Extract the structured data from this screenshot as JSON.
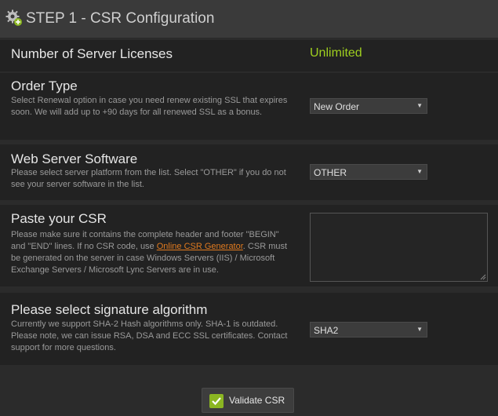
{
  "header": {
    "title": "STEP 1 - CSR Configuration"
  },
  "licenses": {
    "label": "Number of Server Licenses",
    "value": "Unlimited",
    "value_color": "#9fcf1f"
  },
  "order_type": {
    "label": "Order Type",
    "desc": "Select Renewal option in case you need renew existing SSL that expires soon. We will add up to +90 days for all renewed SSL as a bonus.",
    "selected": "New Order"
  },
  "web_server": {
    "label": "Web Server Software",
    "desc": "Please select server platform from the list. Select \"OTHER\" if you do not see your server software in the list.",
    "selected": "OTHER"
  },
  "csr": {
    "label": "Paste your CSR",
    "desc_before": "Please make sure it contains the complete header and footer \"BEGIN\" and \"END\" lines. If no CSR code, use ",
    "link": "Online CSR Generator",
    "desc_after": ". CSR must be generated on the server in case Windows Servers (IIS) / Microsoft Exchange Servers / Microsoft Lync Servers are in use.",
    "value": ""
  },
  "signature": {
    "label": "Please select signature algorithm",
    "desc": "Currently we support SHA-2 Hash algorithms only. SHA-1 is outdated. Please note, we can issue RSA, DSA and ECC SSL certificates. Contact support for more questions.",
    "selected": "SHA2"
  },
  "validate_button": {
    "label": "Validate CSR"
  },
  "icons": {
    "header": "gear-icon",
    "select_arrow": "caret-down-icon",
    "button": "check-icon"
  },
  "colors": {
    "accent": "#9fcf1f",
    "link": "#e07a1f"
  }
}
